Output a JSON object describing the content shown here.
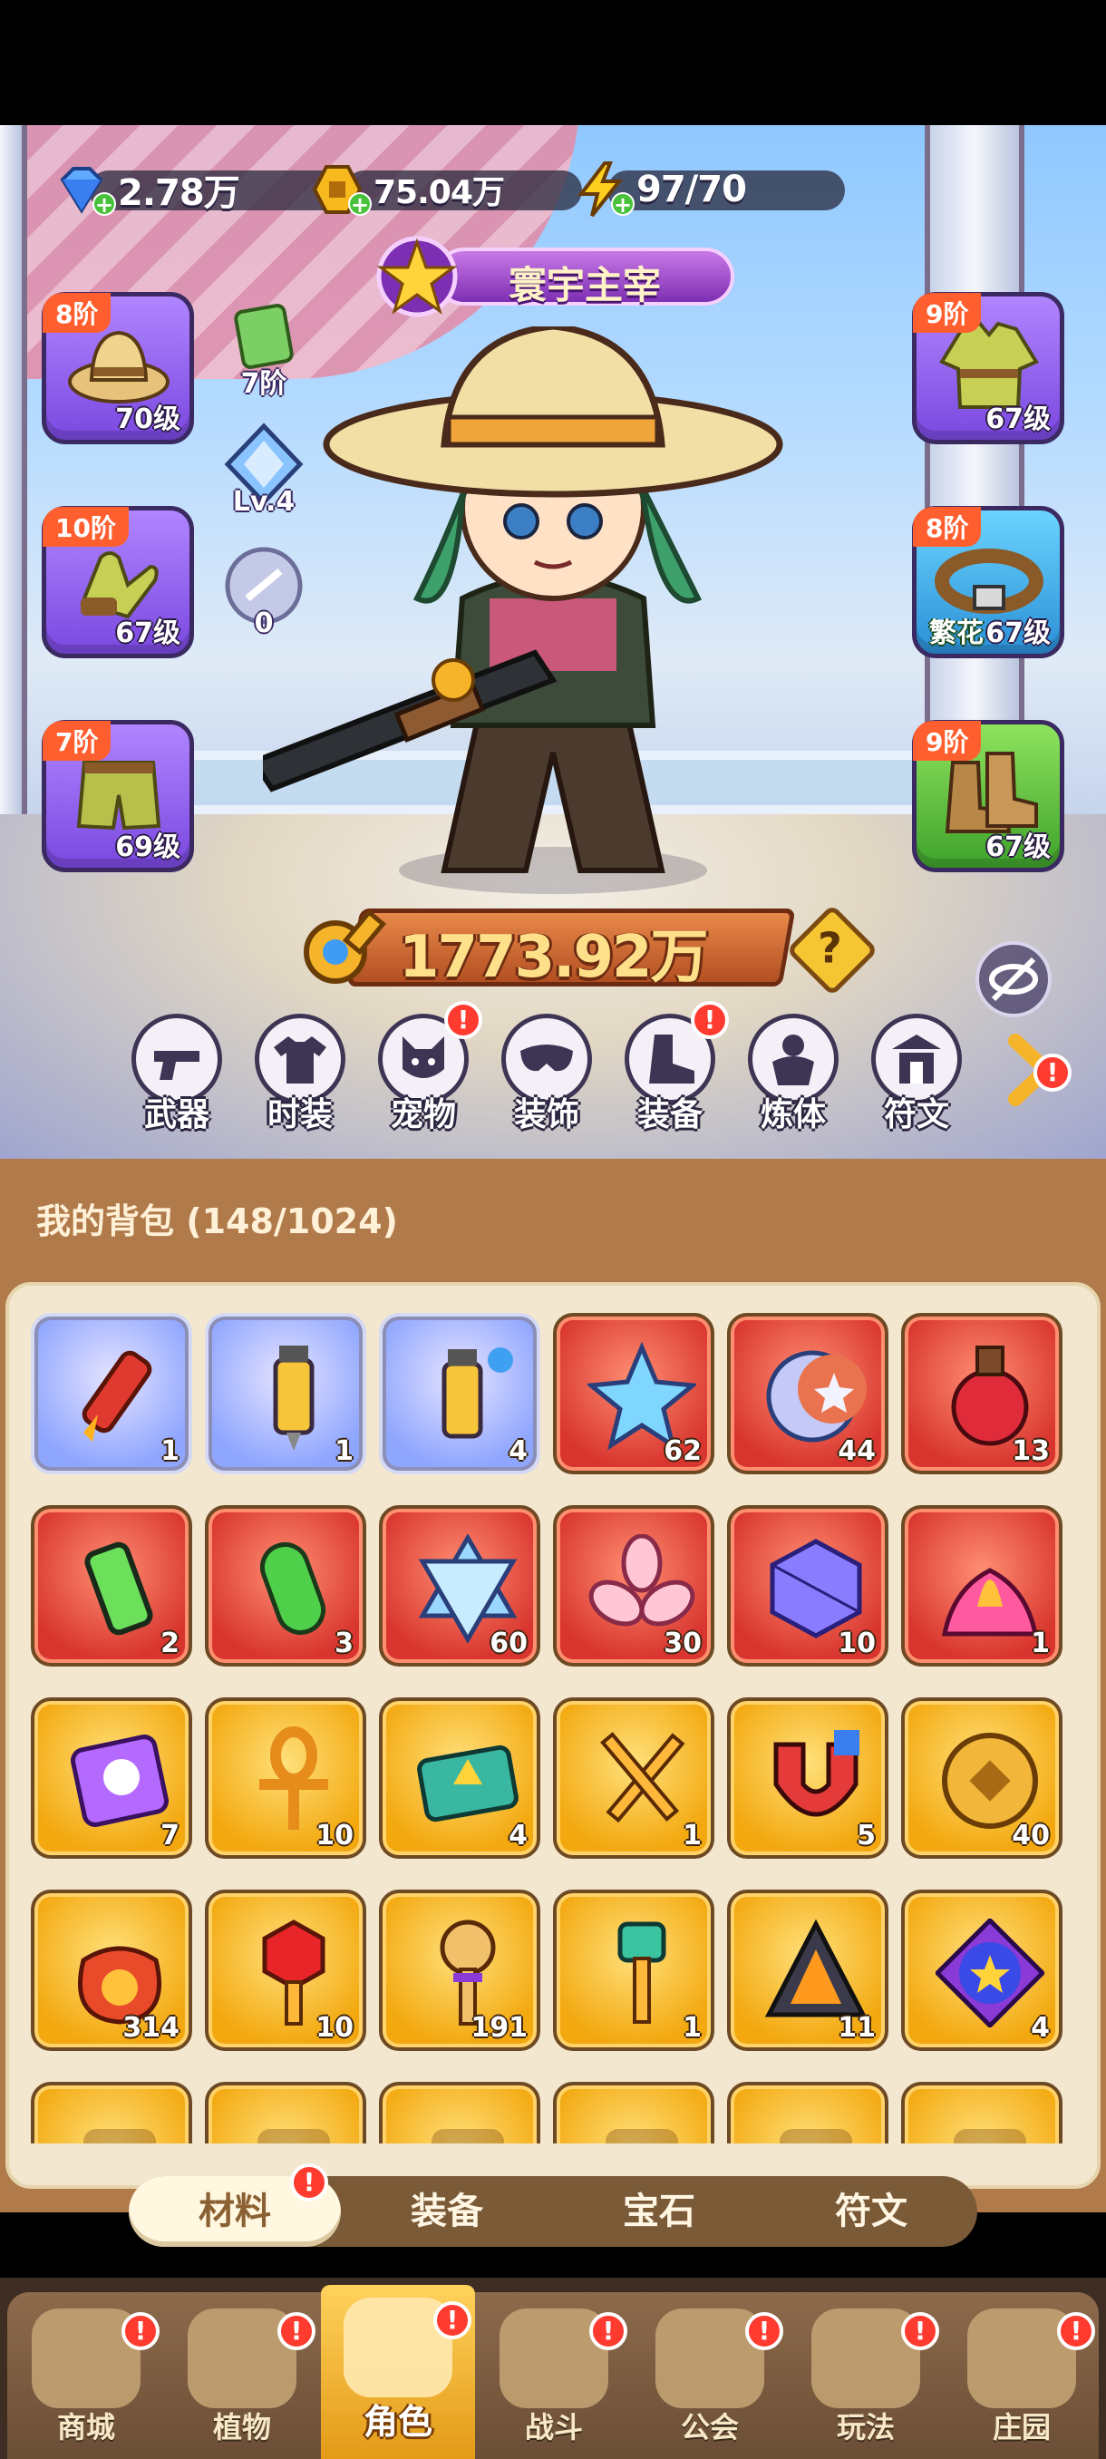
{
  "currency": {
    "gems": "2.78万",
    "coins": "75.04万",
    "energy": "97/70"
  },
  "title_banner": "寰宇主宰",
  "equipment": {
    "hat": {
      "tier": "8阶",
      "level": "70级"
    },
    "gloves": {
      "tier": "10阶",
      "level": "67级"
    },
    "pants": {
      "tier": "7阶",
      "level": "69级"
    },
    "jacket": {
      "tier": "9阶",
      "level": "67级"
    },
    "belt": {
      "tier": "8阶",
      "level": "67级",
      "tag": "繁花"
    },
    "boots": {
      "tier": "9阶",
      "level": "67级"
    }
  },
  "mini_stats": {
    "scroll": "7阶",
    "crystal": "Lv.4",
    "orb": "0"
  },
  "power": "1773.92万",
  "function_nav": [
    {
      "label": "武器",
      "badge": false
    },
    {
      "label": "时装",
      "badge": false
    },
    {
      "label": "宠物",
      "badge": true
    },
    {
      "label": "装饰",
      "badge": false
    },
    {
      "label": "装备",
      "badge": true
    },
    {
      "label": "炼体",
      "badge": false
    },
    {
      "label": "符文",
      "badge": false
    }
  ],
  "badge_symbol": "!",
  "help_symbol": "?",
  "inventory": {
    "title": "我的背包 (148/1024)",
    "rows": [
      [
        {
          "icon": "firework-rocket-icon",
          "rarity": "blue",
          "count": "1"
        },
        {
          "icon": "syringe-icon",
          "rarity": "blue",
          "count": "1"
        },
        {
          "icon": "syringe-splash-icon",
          "rarity": "blue",
          "count": "4"
        },
        {
          "icon": "blue-star-gem-icon",
          "rarity": "red",
          "count": "62"
        },
        {
          "icon": "crescent-moon-star-icon",
          "rarity": "red",
          "count": "44"
        },
        {
          "icon": "red-potion-icon",
          "rarity": "red",
          "count": "13"
        }
      ],
      [
        {
          "icon": "green-canister-icon",
          "rarity": "red",
          "count": "2"
        },
        {
          "icon": "green-capsule-icon",
          "rarity": "red",
          "count": "3"
        },
        {
          "icon": "hexagram-crystal-icon",
          "rarity": "red",
          "count": "60"
        },
        {
          "icon": "pink-flower-gem-icon",
          "rarity": "red",
          "count": "30"
        },
        {
          "icon": "purple-cube-cluster-icon",
          "rarity": "red",
          "count": "10"
        },
        {
          "icon": "lotus-fire-icon",
          "rarity": "red",
          "count": "1"
        }
      ],
      [
        {
          "icon": "skull-scroll-icon",
          "rarity": "gold",
          "count": "7"
        },
        {
          "icon": "ankh-icon",
          "rarity": "gold",
          "count": "10"
        },
        {
          "icon": "upgrade-ticket-icon",
          "rarity": "gold",
          "count": "4"
        },
        {
          "icon": "crossed-swords-icon",
          "rarity": "gold",
          "count": "1"
        },
        {
          "icon": "magnet-icon",
          "rarity": "gold",
          "count": "5"
        },
        {
          "icon": "gold-coin-icon",
          "rarity": "gold",
          "count": "40"
        }
      ],
      [
        {
          "icon": "lucky-bag-icon",
          "rarity": "gold",
          "count": "314"
        },
        {
          "icon": "ruby-key-icon",
          "rarity": "gold",
          "count": "10"
        },
        {
          "icon": "purple-key-icon",
          "rarity": "gold",
          "count": "191"
        },
        {
          "icon": "emerald-key-icon",
          "rarity": "gold",
          "count": "1"
        },
        {
          "icon": "fire-prism-icon",
          "rarity": "gold",
          "count": "11"
        },
        {
          "icon": "purple-orb-icon",
          "rarity": "gold",
          "count": "4"
        }
      ],
      [
        {
          "icon": "partial-item-icon",
          "rarity": "gold",
          "count": ""
        },
        {
          "icon": "partial-item-icon",
          "rarity": "gold",
          "count": ""
        },
        {
          "icon": "partial-item-icon",
          "rarity": "gold",
          "count": ""
        },
        {
          "icon": "partial-item-icon",
          "rarity": "gold",
          "count": ""
        },
        {
          "icon": "partial-item-icon",
          "rarity": "gold",
          "count": ""
        },
        {
          "icon": "partial-item-icon",
          "rarity": "gold",
          "count": ""
        }
      ]
    ]
  },
  "tabs": [
    {
      "label": "材料",
      "active": true,
      "badge": true
    },
    {
      "label": "装备",
      "active": false,
      "badge": false
    },
    {
      "label": "宝石",
      "active": false,
      "badge": false
    },
    {
      "label": "符文",
      "active": false,
      "badge": false
    }
  ],
  "bottom_nav": [
    {
      "label": "商城",
      "active": false,
      "badge": true
    },
    {
      "label": "植物",
      "active": false,
      "badge": true
    },
    {
      "label": "角色",
      "active": true,
      "badge": true
    },
    {
      "label": "战斗",
      "active": false,
      "badge": true
    },
    {
      "label": "公会",
      "active": false,
      "badge": true
    },
    {
      "label": "玩法",
      "active": false,
      "badge": true
    },
    {
      "label": "庄园",
      "active": false,
      "badge": true
    }
  ],
  "colors": {
    "panel_brown": "#b07a4a",
    "panel_cream": "#f3e8cf",
    "rarity_blue": "#8fa6ff",
    "rarity_red": "#d8352e",
    "rarity_gold": "#f3a80f",
    "badge_red": "#ff3b30"
  }
}
